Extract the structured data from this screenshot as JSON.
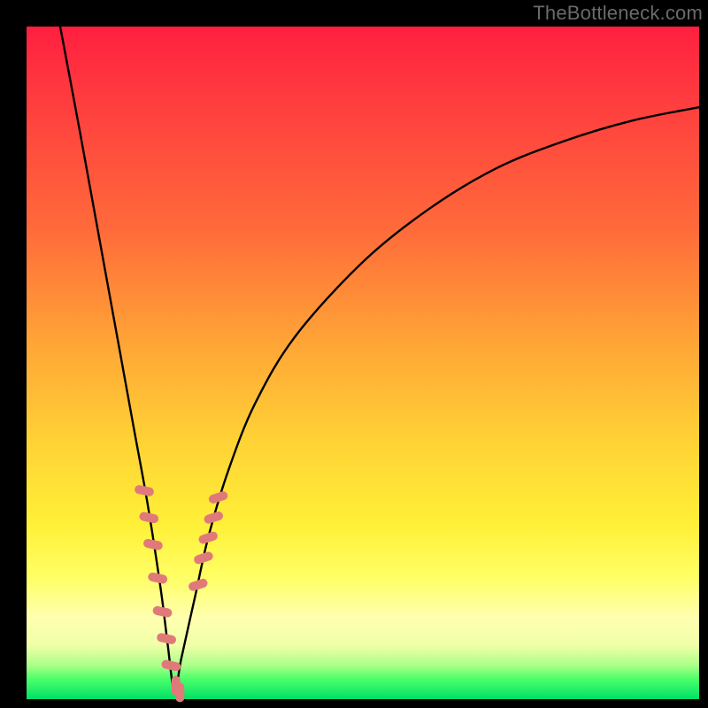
{
  "watermark": "TheBottleneck.com",
  "colors": {
    "background": "#000000",
    "gradient_top": "#ff1f3f",
    "gradient_mid": "#ffd335",
    "gradient_bottom": "#00e066",
    "curve": "#000000",
    "markers": "#e07a7a"
  },
  "chart_data": {
    "type": "line",
    "title": "",
    "xlabel": "",
    "ylabel": "",
    "xlim": [
      0,
      100
    ],
    "ylim": [
      0,
      100
    ],
    "note": "V-shaped bottleneck curve; x≈ratio, y≈mismatch %. Minimum near x≈22 (y≈0). Axes unlabeled in source.",
    "series": [
      {
        "name": "bottleneck-curve",
        "x": [
          5,
          8,
          10,
          12,
          14,
          16,
          18,
          20,
          21,
          22,
          23,
          25,
          27,
          30,
          34,
          40,
          50,
          60,
          70,
          80,
          90,
          100
        ],
        "y": [
          100,
          84,
          73,
          62,
          51,
          40,
          29,
          16,
          8,
          1,
          6,
          15,
          24,
          34,
          44,
          54,
          65,
          73,
          79,
          83,
          86,
          88
        ]
      }
    ],
    "markers": {
      "name": "highlight-points",
      "shape": "rounded-rect",
      "x": [
        17.5,
        18.2,
        18.8,
        19.5,
        20.2,
        20.8,
        21.5,
        22.2,
        22.8,
        25.5,
        26.3,
        27.0,
        27.8,
        28.5
      ],
      "y": [
        31,
        27,
        23,
        18,
        13,
        9,
        5,
        2,
        1,
        17,
        21,
        24,
        27,
        30
      ]
    }
  }
}
